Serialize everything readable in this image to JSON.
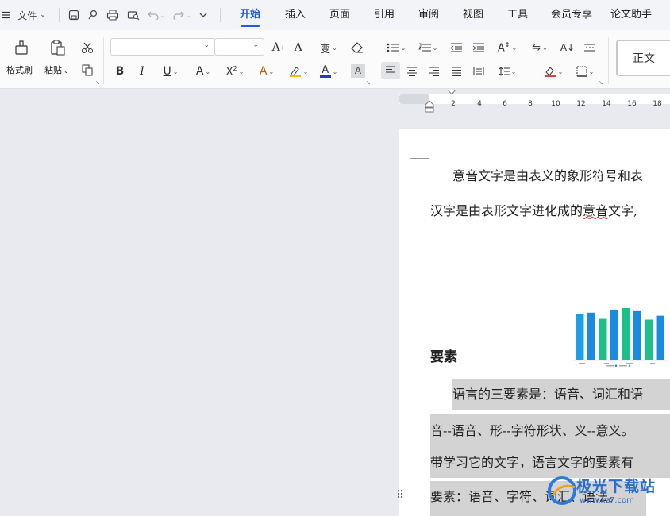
{
  "menubar": {
    "menu_icon": "hamburger-icon",
    "file_label": "文件",
    "quick_icons": [
      "save-icon",
      "export-icon",
      "print-icon",
      "print-preview-icon",
      "undo-icon",
      "redo-icon",
      "more-icon"
    ]
  },
  "tabs": [
    "开始",
    "插入",
    "页面",
    "引用",
    "审阅",
    "视图",
    "工具",
    "会员专享",
    "论文助手"
  ],
  "active_tab": "开始",
  "ribbon": {
    "format_painter_label": "格式刷",
    "paste_label": "粘贴",
    "font_name_value": "",
    "font_size_value": "",
    "style_preview_label": "正文",
    "font_color": "#1f3bd0",
    "accent_color": "#1b5ce0"
  },
  "ruler": {
    "ticks": [
      "2",
      "4",
      "6",
      "8",
      "10",
      "12",
      "14",
      "16",
      "18"
    ]
  },
  "document": {
    "para1_line1": "意音文字是由表义的象形符号和表",
    "para2_line1_a": "汉字是由表形文字进化成的",
    "para2_line1_underlined": "意音",
    "para2_line1_b": "文字,",
    "heading": "要素",
    "sel_line1": "语言的三要素是：语音、词汇和语",
    "sel_line2": "音--语音、形--字符形状、义--意义。",
    "sel_line3": "带学习它的文字，语言文字的要素有",
    "sel_line4": "要素：语音、字符、词汇、语法。"
  },
  "watermark": {
    "text": "极光下载站",
    "subtext": "www.xz7.com"
  },
  "chart_data": {
    "type": "bar",
    "values": [
      60,
      62,
      54,
      66,
      68,
      64,
      53,
      58
    ],
    "colors": [
      "#1aa0e8",
      "#1a8be0",
      "#1dbf8a",
      "#1a8be0",
      "#1dbf8a",
      "#1a8be0",
      "#1dbf8a",
      "#1a8be0"
    ]
  }
}
